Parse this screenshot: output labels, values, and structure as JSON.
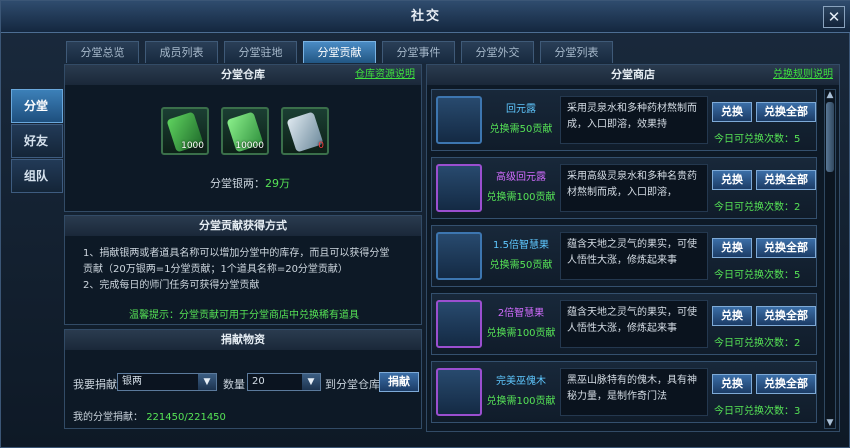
{
  "window": {
    "title": "社交",
    "close_label": "✕"
  },
  "side_tabs": [
    {
      "label": "分堂"
    },
    {
      "label": "好友"
    },
    {
      "label": "组队"
    }
  ],
  "tabs": [
    {
      "label": "分堂总览"
    },
    {
      "label": "成员列表"
    },
    {
      "label": "分堂驻地"
    },
    {
      "label": "分堂贡献"
    },
    {
      "label": "分堂事件"
    },
    {
      "label": "分堂外交"
    },
    {
      "label": "分堂列表"
    }
  ],
  "warehouse": {
    "title": "分堂仓库",
    "link": "仓库资源说明",
    "items": [
      {
        "count": "1000",
        "icon": "jade-token-icon"
      },
      {
        "count": "10000",
        "icon": "green-jade-icon"
      },
      {
        "count": "0",
        "icon": "silver-jade-icon"
      }
    ],
    "silver_label": "分堂银两：",
    "silver_value": "29万"
  },
  "methods": {
    "title": "分堂贡献获得方式",
    "line1": "1、捐献银两或者道具名称可以增加分堂中的库存，而且可以获得分堂",
    "line2": "贡献（20万银两=1分堂贡献；1个道具名称=20分堂贡献）",
    "line3": "2、完成每日的师门任务可获得分堂贡献",
    "tip": "温馨提示：分堂贡献可用于分堂商店中兑换稀有道具"
  },
  "donate": {
    "title": "捐献物资",
    "want_label": "我要捐献",
    "item_select": "银两",
    "qty_label": "数量",
    "qty_select": "20",
    "to_label": "到分堂仓库",
    "button": "捐献",
    "my_label": "我的分堂捐献：",
    "my_value": "221450/221450"
  },
  "shop": {
    "title": "分堂商店",
    "link": "兑换规则说明",
    "exchange": "兑换",
    "exchange_all": "兑换全部",
    "items": [
      {
        "name": "回元露",
        "name_color": "#5fc8ff",
        "cost": "兑换需50贡献",
        "desc": "采用灵泉水和多种药材熬制而成，入口即溶，效果持",
        "times": "今日可兑换次数：5",
        "icon": "red-potion-icon"
      },
      {
        "name": "高级回元露",
        "name_color": "#d26cff",
        "cost": "兑换需100贡献",
        "desc": "采用高级灵泉水和多种名贵药材熬制而成，入口即溶，",
        "times": "今日可兑换次数：2",
        "icon": "crown-potion-icon"
      },
      {
        "name": "1.5倍智慧果",
        "name_color": "#5fc8ff",
        "cost": "兑换需50贡献",
        "desc": "蕴含天地之灵气的果实，可使人悟性大涨，修炼起来事",
        "times": "今日可兑换次数：5",
        "icon": "wisdom-fruit-icon"
      },
      {
        "name": "2倍智慧果",
        "name_color": "#d26cff",
        "cost": "兑换需100贡献",
        "desc": "蕴含天地之灵气的果实，可使人悟性大涨，修炼起来事",
        "times": "今日可兑换次数：2",
        "icon": "wisdom-fruit-2-icon"
      },
      {
        "name": "完美巫傀木",
        "name_color": "#5fc8ff",
        "cost": "兑换需100贡献",
        "desc": "黑巫山脉特有的傀木，具有神秘力量，是制作奇门法",
        "times": "今日可兑换次数：3",
        "icon": "puppet-wood-icon"
      }
    ]
  }
}
